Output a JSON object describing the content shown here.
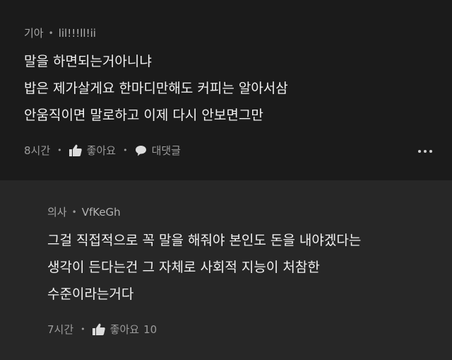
{
  "comment": {
    "author_label": "기아",
    "username": "lil!!!ll!ii",
    "lines": [
      "말을 하면되는거아니냐",
      "밥은 제가살게요 한마디만해도 커피는 알아서삼",
      "안움직이면 말로하고 이제 다시 안보면그만"
    ],
    "time": "8시간",
    "like_label": "좋아요",
    "reply_label": "대댓글"
  },
  "reply": {
    "author_label": "의사",
    "username": "VfKeGh",
    "lines": [
      "그걸 직접적으로 꼭 말을 해줘야 본인도 돈을 내야겠다는",
      "생각이 든다는건 그 자체로 사회적 지능이 처참한",
      "수준이라는거다"
    ],
    "time": "7시간",
    "like_label": "좋아요",
    "like_count": "10"
  },
  "icons": [
    "thumbs-up-icon",
    "speech-bubble-icon",
    "more-options-icon"
  ]
}
